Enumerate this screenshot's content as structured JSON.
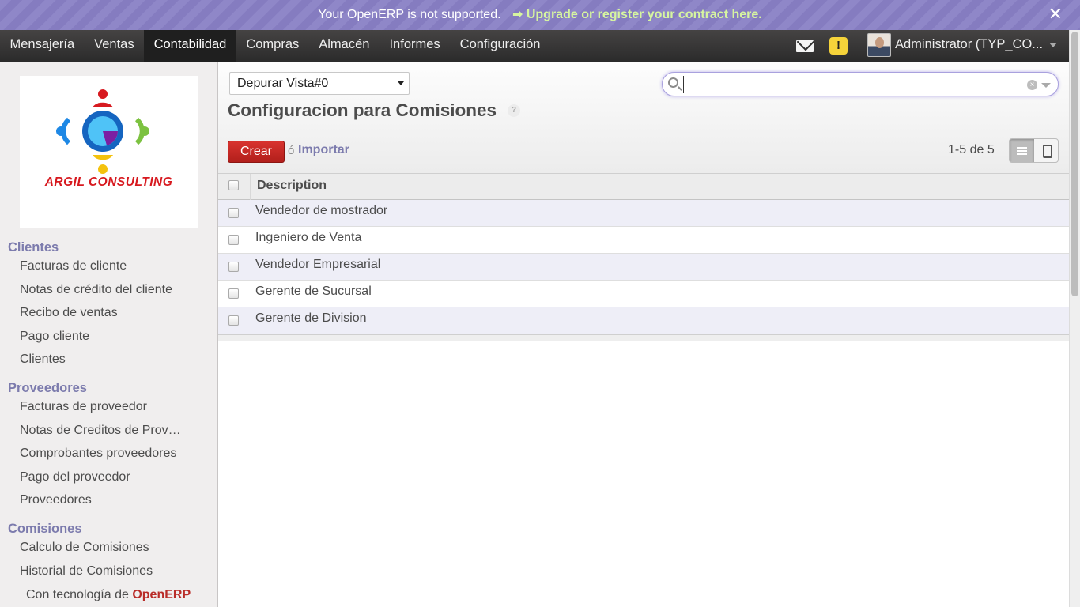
{
  "announcement": {
    "message": "Your OpenERP is not supported.",
    "link": "➡ Upgrade or register your contract here.",
    "close": "✕"
  },
  "topmenu": {
    "items": [
      "Mensajería",
      "Ventas",
      "Contabilidad",
      "Compras",
      "Almacén",
      "Informes",
      "Configuración"
    ],
    "active": "Contabilidad",
    "user": "Administrator (TYP_CO..."
  },
  "sidebar": {
    "logo_text": "ARGIL CONSULTING",
    "sections": [
      {
        "title": "Clientes",
        "items": [
          "Facturas de cliente",
          "Notas de crédito del cliente",
          "Recibo de ventas",
          "Pago cliente",
          "Clientes"
        ]
      },
      {
        "title": "Proveedores",
        "items": [
          "Facturas de proveedor",
          "Notas de Creditos de Proveedores",
          "Comprobantes proveedores",
          "Pago del proveedor",
          "Proveedores"
        ]
      },
      {
        "title": "Comisiones",
        "items": [
          "Calculo de Comisiones",
          "Historial de Comisiones"
        ]
      }
    ],
    "powered_prefix": "Con tecnología de",
    "powered_brand": "OpenERP"
  },
  "header": {
    "view_select": "Depurar Vista#0",
    "title": "Configuracion para Comisiones",
    "help": "?",
    "search_placeholder": "",
    "create_label": "Crear",
    "or_text": "ó",
    "import_label": "Importar",
    "pager": "1-5 de 5"
  },
  "list": {
    "column": "Description",
    "rows": [
      "Vendedor de mostrador",
      "Ingeniero de Venta",
      "Vendedor Empresarial",
      "Gerente de Sucursal",
      "Gerente de Division"
    ]
  },
  "colors": {
    "brand_purple": "#7c7bad",
    "create_red": "#c9302c",
    "logo_red": "#d7191f"
  }
}
